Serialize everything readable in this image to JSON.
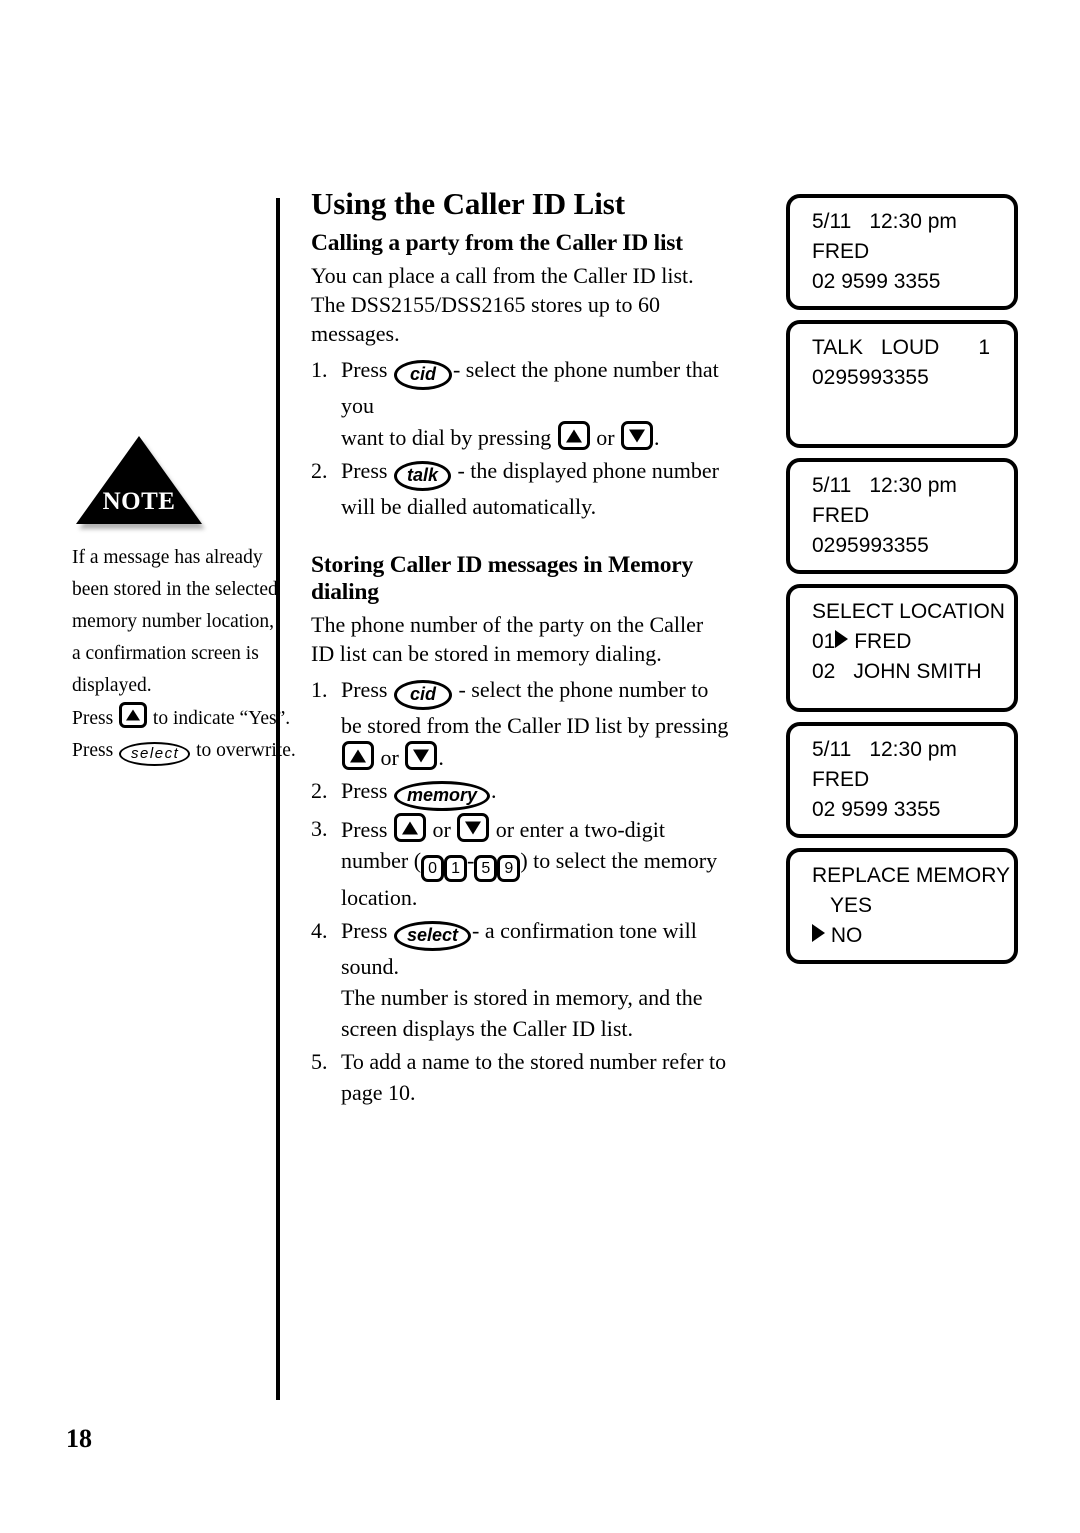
{
  "page_number": "18",
  "note": {
    "badge_label": "NOTE",
    "lines": [
      "If a message has already",
      "been stored in the selected",
      "memory number location,",
      "a confirmation screen is",
      "displayed."
    ],
    "press_yes_prefix": "Press",
    "press_yes_suffix": "to indicate “Yes”.",
    "press_select_prefix": "Press",
    "press_select_button": "select",
    "press_select_suffix": "to overwrite."
  },
  "main": {
    "title": "Using the Caller ID List",
    "section1": {
      "heading": "Calling a party from the Caller ID list",
      "paragraph_line1": "You can place a call from the Caller ID list.",
      "paragraph_line2": "The DSS2155/DSS2165 stores up to 60 messages.",
      "steps": [
        {
          "num": "1.",
          "lead": "Press",
          "button": "cid",
          "text_a": "- select the phone number that you",
          "text_b": "want to dial by pressing",
          "conj": "or",
          "text_c": "."
        },
        {
          "num": "2.",
          "lead": "Press",
          "button": "talk",
          "text_a": "- the displayed phone number",
          "text_b": "will be dialled automatically."
        }
      ]
    },
    "section2": {
      "heading": "Storing Caller ID messages in Memory dialing",
      "paragraph_line1": "The phone number of the party on the Caller",
      "paragraph_line2": "ID list can be stored in memory dialing.",
      "steps": [
        {
          "num": "1.",
          "lead": "Press",
          "button": "cid",
          "text_a": "- select the phone number to",
          "text_b": "be stored from the Caller ID list by pressing",
          "conj": "or",
          "text_c": "."
        },
        {
          "num": "2.",
          "lead": "Press",
          "button": "memory",
          "text_a": "."
        },
        {
          "num": "3.",
          "lead": "Press",
          "conj": "or",
          "text_a": "or enter a two-digit",
          "text_b": "number (",
          "key_0": "0",
          "key_1": "1",
          "dash": "-",
          "key_5": "5",
          "key_9": "9",
          "text_c": ") to select the memory",
          "text_d": "location."
        },
        {
          "num": "4.",
          "lead": "Press",
          "button": "select",
          "text_a": "- a confirmation tone will sound.",
          "text_b": "The number is stored in memory, and the",
          "text_c": "screen displays the Caller ID list."
        },
        {
          "num": "5.",
          "text_a": "To add a name to the stored number refer to",
          "text_b": "page 10."
        }
      ]
    }
  },
  "lcd_screens": [
    {
      "name": "caller-id-entry-1",
      "rows": [
        {
          "date": "5/11",
          "time": "12:30 pm"
        },
        {
          "text": "FRED"
        },
        {
          "text": "02 9599 3355"
        }
      ]
    },
    {
      "name": "talk-loud-status",
      "rows": [
        {
          "left": "TALK",
          "middle": "LOUD",
          "right": "1"
        },
        {
          "text": "0295993355"
        },
        {
          "text": ""
        }
      ]
    },
    {
      "name": "caller-id-entry-2",
      "rows": [
        {
          "date": "5/11",
          "time": "12:30 pm"
        },
        {
          "text": "FRED"
        },
        {
          "text": "0295993355"
        }
      ]
    },
    {
      "name": "select-location",
      "rows": [
        {
          "text": "SELECT LOCATION"
        },
        {
          "index": "01",
          "arrow": true,
          "label": "FRED"
        },
        {
          "index": "02",
          "arrow": false,
          "label": "JOHN SMITH"
        }
      ]
    },
    {
      "name": "caller-id-entry-3",
      "rows": [
        {
          "date": "5/11",
          "time": "12:30 pm"
        },
        {
          "text": "FRED"
        },
        {
          "text": "02 9599 3355"
        }
      ]
    },
    {
      "name": "replace-memory-confirm",
      "rows": [
        {
          "text": "REPLACE MEMORY"
        },
        {
          "text": "YES"
        },
        {
          "arrow": true,
          "label": "NO"
        }
      ]
    }
  ]
}
